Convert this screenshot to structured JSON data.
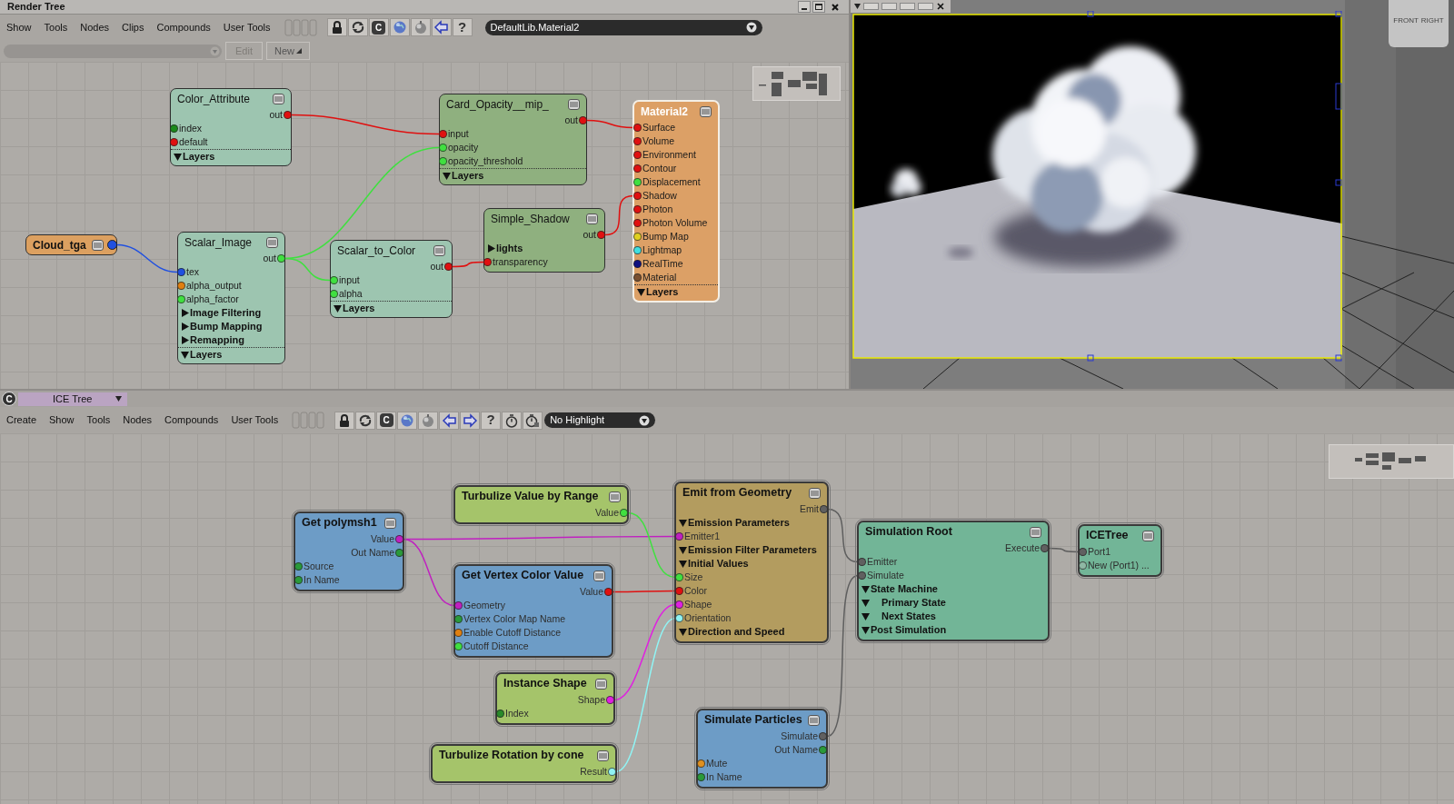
{
  "render_tree": {
    "title": "Render Tree",
    "menu": [
      "Show",
      "Tools",
      "Nodes",
      "Clips",
      "Compounds",
      "User Tools"
    ],
    "c_button": "C",
    "help_button": "?",
    "material_dropdown": "DefaultLib.Material2",
    "edit_button": {
      "label": "Edit",
      "disabled": true
    },
    "new_button": {
      "label": "New",
      "disabled": false
    },
    "nodes": [
      {
        "name": "Color_Attribute",
        "kind": "shader",
        "rows": [
          {
            "kind": "output",
            "label": "out",
            "color": "#e01010"
          },
          {
            "kind": "input",
            "label": "index",
            "color": "#1a8a1a"
          },
          {
            "kind": "input",
            "label": "default",
            "color": "#e01010"
          },
          {
            "kind": "group",
            "label": "Layers",
            "expanded": true
          }
        ]
      },
      {
        "name": "Card_Opacity__mip_",
        "kind": "mixer",
        "rows": [
          {
            "kind": "output",
            "label": "out",
            "color": "#e01010"
          },
          {
            "kind": "input",
            "label": "input",
            "color": "#e01010"
          },
          {
            "kind": "input",
            "label": "opacity",
            "color": "#40e040"
          },
          {
            "kind": "input",
            "label": "opacity_threshold",
            "color": "#40e040"
          },
          {
            "kind": "group",
            "label": "Layers",
            "expanded": true
          }
        ]
      },
      {
        "name": "Material2",
        "kind": "material",
        "rows": [
          {
            "kind": "input",
            "label": "Surface",
            "color": "#e01010"
          },
          {
            "kind": "input",
            "label": "Volume",
            "color": "#e01010"
          },
          {
            "kind": "input",
            "label": "Environment",
            "color": "#e01010"
          },
          {
            "kind": "input",
            "label": "Contour",
            "color": "#e01010"
          },
          {
            "kind": "input",
            "label": "Displacement",
            "color": "#40e040"
          },
          {
            "kind": "input",
            "label": "Shadow",
            "color": "#e01010"
          },
          {
            "kind": "input",
            "label": "Photon",
            "color": "#e01010"
          },
          {
            "kind": "input",
            "label": "Photon Volume",
            "color": "#e01010"
          },
          {
            "kind": "input",
            "label": "Bump Map",
            "color": "#e0d020"
          },
          {
            "kind": "input",
            "label": "Lightmap",
            "color": "#40e0e0"
          },
          {
            "kind": "input",
            "label": "RealTime",
            "color": "#101080"
          },
          {
            "kind": "input",
            "label": "Material",
            "color": "#7a5030"
          },
          {
            "kind": "group",
            "label": "Layers",
            "expanded": true
          }
        ]
      },
      {
        "name": "Simple_Shadow",
        "kind": "mixer",
        "rows": [
          {
            "kind": "output",
            "label": "out",
            "color": "#e01010"
          },
          {
            "kind": "group",
            "label": "lights",
            "expanded": false
          },
          {
            "kind": "input",
            "label": "transparency",
            "color": "#e01010"
          }
        ]
      },
      {
        "name": "Cloud_tga",
        "kind": "image",
        "output_port": {
          "color": "#2050e0"
        }
      },
      {
        "name": "Scalar_Image",
        "kind": "shader",
        "rows": [
          {
            "kind": "output",
            "label": "out",
            "color": "#40e040"
          },
          {
            "kind": "input",
            "label": "tex",
            "color": "#2050e0"
          },
          {
            "kind": "input",
            "label": "alpha_output",
            "color": "#e08010"
          },
          {
            "kind": "input",
            "label": "alpha_factor",
            "color": "#40e040"
          },
          {
            "kind": "group",
            "label": "Image Filtering",
            "expanded": false
          },
          {
            "kind": "group",
            "label": "Bump Mapping",
            "expanded": false
          },
          {
            "kind": "group",
            "label": "Remapping",
            "expanded": false
          },
          {
            "kind": "group",
            "label": "Layers",
            "expanded": true
          }
        ]
      },
      {
        "name": "Scalar_to_Color",
        "kind": "shader",
        "rows": [
          {
            "kind": "output",
            "label": "out",
            "color": "#e01010"
          },
          {
            "kind": "input",
            "label": "input",
            "color": "#40e040"
          },
          {
            "kind": "input",
            "label": "alpha",
            "color": "#40e040"
          },
          {
            "kind": "group",
            "label": "Layers",
            "expanded": true
          }
        ]
      }
    ]
  },
  "viewport": {
    "view_cube": [
      "FRONT",
      "RIGHT"
    ]
  },
  "ice_tree": {
    "panel_button": "C",
    "view_selector": "ICE Tree",
    "menu": [
      "Create",
      "Show",
      "Tools",
      "Nodes",
      "Compounds",
      "User Tools"
    ],
    "c_button": "C",
    "help_button": "?",
    "highlight_dropdown": "No Highlight",
    "nodes": [
      {
        "name": "Turbulize Value by Range",
        "kind": "compound",
        "rows": [
          {
            "kind": "output",
            "label": "Value",
            "color": "#40e040"
          }
        ]
      },
      {
        "name": "Emit from Geometry",
        "kind": "emitter",
        "rows": [
          {
            "kind": "output",
            "label": "Emit",
            "color": "#606060"
          },
          {
            "kind": "group",
            "label": "Emission Parameters",
            "expanded": true
          },
          {
            "kind": "input",
            "label": "Emitter1",
            "color": "#c020c0"
          },
          {
            "kind": "group",
            "label": "Emission Filter Parameters",
            "expanded": true
          },
          {
            "kind": "group",
            "label": "Initial Values",
            "expanded": true
          },
          {
            "kind": "input",
            "label": "Size",
            "color": "#40e040"
          },
          {
            "kind": "input",
            "label": "Color",
            "color": "#e01010"
          },
          {
            "kind": "input",
            "label": "Shape",
            "color": "#e020e0"
          },
          {
            "kind": "input",
            "label": "Orientation",
            "color": "#90f4f4"
          },
          {
            "kind": "group",
            "label": "Direction and Speed",
            "expanded": true
          }
        ]
      },
      {
        "name": "Get polymsh1",
        "kind": "data",
        "rows": [
          {
            "kind": "output",
            "label": "Value",
            "color": "#c020c0"
          },
          {
            "kind": "output",
            "label": "Out Name",
            "color": "#2a9a3a"
          },
          {
            "kind": "input",
            "label": "Source",
            "color": "#2a9a3a"
          },
          {
            "kind": "input",
            "label": "In Name",
            "color": "#2a9a3a"
          }
        ]
      },
      {
        "name": "Simulation Root",
        "kind": "root",
        "rows": [
          {
            "kind": "output",
            "label": "Execute",
            "color": "#606060"
          },
          {
            "kind": "input",
            "label": "Emitter",
            "color": "#606060"
          },
          {
            "kind": "input",
            "label": "Simulate",
            "color": "#606060"
          },
          {
            "kind": "group",
            "label": "State Machine",
            "expanded": true,
            "children": [
              {
                "kind": "group",
                "label": "Primary State",
                "expanded": true
              },
              {
                "kind": "group",
                "label": "Next States",
                "expanded": true
              }
            ]
          },
          {
            "kind": "group",
            "label": "Post Simulation",
            "expanded": true
          }
        ]
      },
      {
        "name": "ICETree",
        "kind": "root",
        "rows": [
          {
            "kind": "input",
            "label": "Port1",
            "color": "#606060"
          },
          {
            "kind": "input",
            "label": "New (Port1) ...",
            "color": "#8fb8a4"
          }
        ]
      },
      {
        "name": "Get Vertex Color Value",
        "kind": "data",
        "rows": [
          {
            "kind": "output",
            "label": "Value",
            "color": "#e01010"
          },
          {
            "kind": "input",
            "label": "Geometry",
            "color": "#c020c0"
          },
          {
            "kind": "input",
            "label": "Vertex Color Map Name",
            "color": "#2a9a3a"
          },
          {
            "kind": "input",
            "label": "Enable Cutoff Distance",
            "color": "#e08010"
          },
          {
            "kind": "input",
            "label": "Cutoff Distance",
            "color": "#40e040"
          }
        ]
      },
      {
        "name": "Instance Shape",
        "kind": "compound",
        "rows": [
          {
            "kind": "output",
            "label": "Shape",
            "color": "#e020e0"
          },
          {
            "kind": "input",
            "label": "Index",
            "color": "#2a8a2a"
          }
        ]
      },
      {
        "name": "Simulate Particles",
        "kind": "data",
        "rows": [
          {
            "kind": "output",
            "label": "Simulate",
            "color": "#606060"
          },
          {
            "kind": "output",
            "label": "Out Name",
            "color": "#2a9a3a"
          },
          {
            "kind": "input",
            "label": "Mute",
            "color": "#e09020"
          },
          {
            "kind": "input",
            "label": "In Name",
            "color": "#2a9a3a"
          }
        ]
      },
      {
        "name": "Turbulize Rotation by cone",
        "kind": "compound",
        "rows": [
          {
            "kind": "output",
            "label": "Result",
            "color": "#90f4f4"
          }
        ]
      }
    ]
  }
}
